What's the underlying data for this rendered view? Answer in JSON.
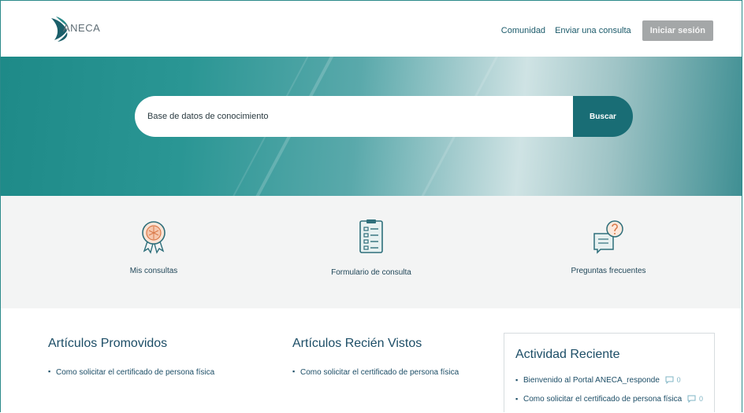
{
  "header": {
    "logo_text": "ANECA",
    "nav": {
      "community": "Comunidad",
      "send_query": "Enviar una consulta"
    },
    "login_label": "Iniciar sesión"
  },
  "hero": {
    "search_placeholder": "Base de datos de conocimiento",
    "search_button": "Buscar"
  },
  "tiles": [
    {
      "label": "Mis consultas",
      "icon": "award-badge-icon"
    },
    {
      "label": "Formulario de consulta",
      "icon": "form-checklist-icon"
    },
    {
      "label": "Preguntas frecuentes",
      "icon": "faq-chat-icon"
    }
  ],
  "promoted": {
    "title": "Artículos Promovidos",
    "items": [
      "Como solicitar el certificado de persona física"
    ]
  },
  "recent_viewed": {
    "title": "Artículos Recién Vistos",
    "items": [
      "Como solicitar el certificado de persona física"
    ]
  },
  "activity": {
    "title": "Actividad Reciente",
    "items": [
      {
        "text": "Bienvenido al Portal ANECA_responde",
        "comments": "0"
      },
      {
        "text": "Como solicitar el certificado de persona física",
        "comments": "0"
      }
    ]
  },
  "colors": {
    "accent": "#196d75",
    "teal": "#2a9694",
    "link": "#1c4d66"
  }
}
